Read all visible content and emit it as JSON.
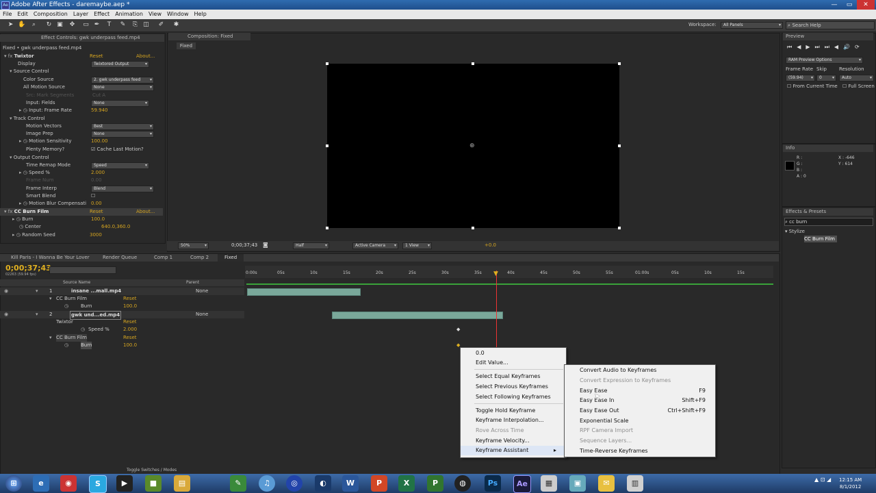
{
  "window": {
    "title": "Adobe After Effects - daremaybe.aep *",
    "app_icon": "Ae"
  },
  "menu": [
    "File",
    "Edit",
    "Composition",
    "Layer",
    "Effect",
    "Animation",
    "View",
    "Window",
    "Help"
  ],
  "toolbar": {
    "workspace_label": "Workspace:",
    "workspace_value": "All Panels",
    "search_placeholder": "Search Help"
  },
  "effect_controls": {
    "tab": "Effect Controls: gwk underpass feed.mp4",
    "header": "Fixed • gwk underpass feed.mp4",
    "rows": [
      {
        "label": "Twixtor",
        "value": "Reset",
        "extra": "About..."
      },
      {
        "label": "Display",
        "value": "Twixtored Output"
      },
      {
        "label": "Source Control",
        "value": ""
      },
      {
        "label": "Color Source",
        "value": "2. gwk underpass feed"
      },
      {
        "label": "All Motion Source",
        "value": "None"
      },
      {
        "label": "Src: Mark Segments",
        "value": "Cut A"
      },
      {
        "label": "Input: Fields",
        "value": "None"
      },
      {
        "label": "Input: Frame Rate",
        "value": "59.940"
      },
      {
        "label": "Track Control",
        "value": ""
      },
      {
        "label": "Motion Vectors",
        "value": "Best"
      },
      {
        "label": "Image Prep",
        "value": "None"
      },
      {
        "label": "Motion Sensitivity",
        "value": "100.00"
      },
      {
        "label": "Plenty Memory?",
        "value": "Cache Last Motion?"
      },
      {
        "label": "Output Control",
        "value": ""
      },
      {
        "label": "Time Remap Mode",
        "value": "Speed"
      },
      {
        "label": "Speed %",
        "value": "2.000"
      },
      {
        "label": "Frame Num",
        "value": "0.00"
      },
      {
        "label": "Frame Interp",
        "value": "Blend"
      },
      {
        "label": "Smart Blend",
        "value": ""
      },
      {
        "label": "Motion Blur Compensati",
        "value": "0.00"
      },
      {
        "label": "CC Burn Film",
        "value": "Reset",
        "extra": "About..."
      },
      {
        "label": "Burn",
        "value": "100.0"
      },
      {
        "label": "Center",
        "value": "640.0,360.0"
      },
      {
        "label": "Random Seed",
        "value": "3000"
      }
    ]
  },
  "composition": {
    "tab": "Composition: Fixed",
    "subtab": "Fixed",
    "footer": {
      "zoom": "50%",
      "timecode": "0;00;37;43",
      "resolution": "Half",
      "camera": "Active Camera",
      "view": "1 View",
      "exposure": "+0.0"
    }
  },
  "preview": {
    "tab": "Preview",
    "ram_option": "RAM Preview Options",
    "frame_rate_label": "Frame Rate",
    "frame_rate": "(59.94)",
    "skip_label": "Skip",
    "skip": "0",
    "resolution_label": "Resolution",
    "resolution": "Auto",
    "from_current": "From Current Time",
    "full_screen": "Full Screen"
  },
  "info": {
    "tab": "Info",
    "r": "R :",
    "g": "G :",
    "b": "B :",
    "a": "A : 0",
    "x": "X : -646",
    "y": "Y : 614"
  },
  "effects_presets": {
    "tab": "Effects & Presets",
    "search": "cc burn",
    "group": "Stylize",
    "item": "CC Burn Film"
  },
  "timeline": {
    "tabs": [
      "Kill Paris - I Wanna Be Your Lover",
      "Render Queue",
      "Comp 1",
      "Comp 2",
      "Fixed"
    ],
    "timecode": "0;00;37;43",
    "fps": "02263 (59.94 fps)",
    "col_source": "Source Name",
    "col_parent": "Parent",
    "ruler": [
      "0:00s",
      "05s",
      "10s",
      "15s",
      "20s",
      "25s",
      "30s",
      "35s",
      "40s",
      "45s",
      "50s",
      "55s",
      "01:00s",
      "05s",
      "10s",
      "15s"
    ],
    "layers": [
      {
        "num": "1",
        "name": "insane ...mall.mp4",
        "parent": "None"
      },
      {
        "label": "CC Burn Film",
        "value": "Reset"
      },
      {
        "label": "Burn",
        "value": "100.0"
      },
      {
        "num": "2",
        "name": "gwk und...ed.mp4",
        "parent": "None"
      },
      {
        "label": "Twixtor",
        "value": "Reset"
      },
      {
        "label": "Speed %",
        "value": "2.000"
      },
      {
        "label": "CC Burn Film",
        "value": "Reset"
      },
      {
        "label": "Burn",
        "value": "100.0"
      }
    ],
    "footer": "Toggle Switches / Modes"
  },
  "context_menu": {
    "items": [
      {
        "label": "0.0",
        "disabled": false
      },
      {
        "label": "Edit Value...",
        "disabled": false
      },
      {
        "label": "Select Equal Keyframes",
        "disabled": false
      },
      {
        "label": "Select Previous Keyframes",
        "disabled": false
      },
      {
        "label": "Select Following Keyframes",
        "disabled": false
      },
      {
        "label": "Toggle Hold Keyframe",
        "disabled": false
      },
      {
        "label": "Keyframe Interpolation...",
        "disabled": false
      },
      {
        "label": "Rove Across Time",
        "disabled": true
      },
      {
        "label": "Keyframe Velocity...",
        "disabled": false
      },
      {
        "label": "Keyframe Assistant",
        "disabled": false
      }
    ]
  },
  "submenu": {
    "items": [
      {
        "label": "Convert Audio to Keyframes",
        "shortcut": "",
        "disabled": false
      },
      {
        "label": "Convert Expression to Keyframes",
        "shortcut": "",
        "disabled": true
      },
      {
        "label": "Easy Ease",
        "shortcut": "F9",
        "disabled": false
      },
      {
        "label": "Easy Ease In",
        "shortcut": "Shift+F9",
        "disabled": false
      },
      {
        "label": "Easy Ease Out",
        "shortcut": "Ctrl+Shift+F9",
        "disabled": false
      },
      {
        "label": "Exponential Scale",
        "shortcut": "",
        "disabled": false
      },
      {
        "label": "RPF Camera Import",
        "shortcut": "",
        "disabled": true
      },
      {
        "label": "Sequence Layers...",
        "shortcut": "",
        "disabled": true
      },
      {
        "label": "Time-Reverse Keyframes",
        "shortcut": "",
        "disabled": false
      }
    ]
  },
  "clock": {
    "time": "12:15 AM",
    "date": "8/1/2012"
  }
}
